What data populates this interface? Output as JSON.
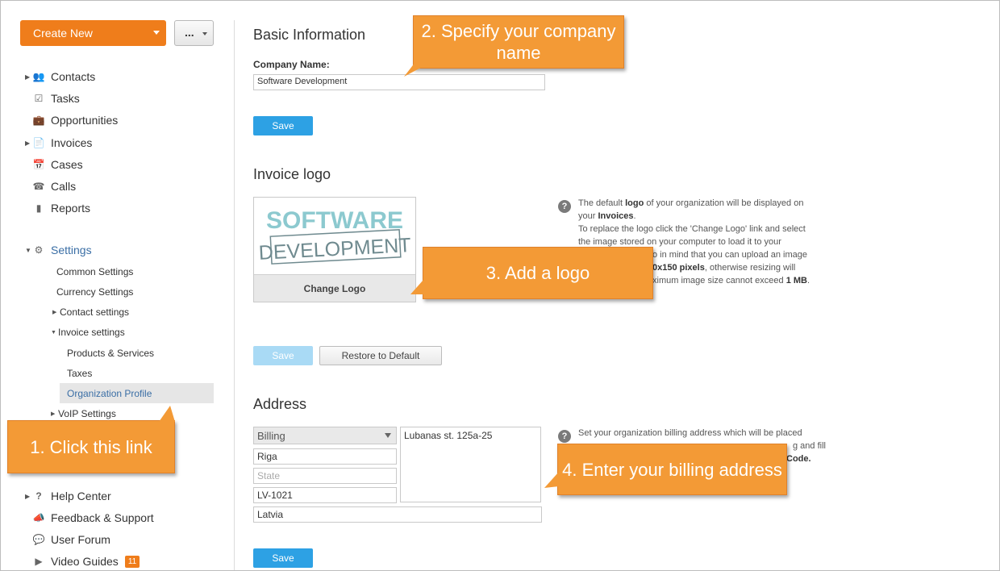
{
  "sidebar": {
    "create_new": "Create New",
    "more": "...",
    "nav": [
      {
        "label": "Contacts",
        "icon": "contacts-icon"
      },
      {
        "label": "Tasks",
        "icon": "tasks-icon"
      },
      {
        "label": "Opportunities",
        "icon": "opportunities-icon"
      },
      {
        "label": "Invoices",
        "icon": "invoices-icon"
      },
      {
        "label": "Cases",
        "icon": "cases-icon"
      },
      {
        "label": "Calls",
        "icon": "calls-icon"
      },
      {
        "label": "Reports",
        "icon": "reports-icon"
      }
    ],
    "settings": "Settings",
    "sub": {
      "common": "Common Settings",
      "currency": "Currency Settings",
      "contact": "Contact settings",
      "invoice": "Invoice settings",
      "products": "Products & Services",
      "taxes": "Taxes",
      "org_profile": "Organization Profile",
      "voip": "VoIP Settings"
    },
    "bottom": [
      {
        "label": "Help Center",
        "icon": "help-icon"
      },
      {
        "label": "Feedback & Support",
        "icon": "megaphone-icon"
      },
      {
        "label": "User Forum",
        "icon": "forum-icon"
      },
      {
        "label": "Video Guides",
        "icon": "video-icon",
        "badge": "11"
      }
    ]
  },
  "main": {
    "basic": {
      "title": "Basic Information",
      "company_label": "Company Name:",
      "company_value": "Software Development",
      "save": "Save"
    },
    "logo": {
      "title": "Invoice logo",
      "logo_line1": "SOFTWARE",
      "logo_line2": "DEVELOPMENT",
      "change": "Change Logo",
      "save": "Save",
      "restore": "Restore to Default",
      "help_p1a": "The default ",
      "help_p1b": "logo",
      "help_p1c": " of your organization will be displayed on your ",
      "help_p1d": "Invoices",
      "help_p1e": ".",
      "help_p2a": "To replace the logo click the 'Change Logo' link and select the image stored on your computer to load it to your",
      "help_p2b": "o in mind that you can upload an image",
      "help_p2c": "0x150 pixels",
      "help_p2d": ", otherwise resizing will",
      "help_p2e": "ximum image size cannot exceed ",
      "help_p2f": "1 MB",
      "help_p2g": "."
    },
    "address": {
      "title": "Address",
      "type": "Billing",
      "city": "Riga",
      "state_placeholder": "State",
      "zip": "LV-1021",
      "country": "Latvia",
      "street": "Lubanas st. 125a-25",
      "save": "Save",
      "help_l1": "Set your organization billing address which will be placed",
      "help_l2": "g and fill",
      "help_l3": "Code."
    }
  },
  "callouts": {
    "c1": "1. Click this link",
    "c2": "2. Specify your company name",
    "c3": "3. Add a logo",
    "c4": "4. Enter your billing address"
  },
  "colors": {
    "accent": "#ef7d1b",
    "button": "#2da1e4",
    "callout": "#f39a36",
    "link": "#3a6ea5"
  }
}
